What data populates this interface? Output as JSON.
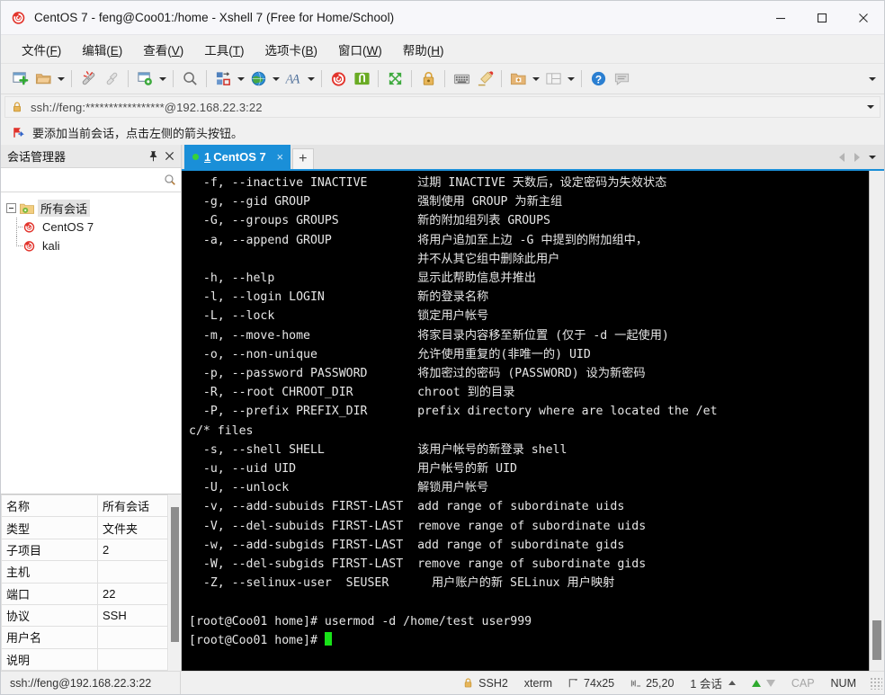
{
  "window": {
    "title": "CentOS 7 - feng@Coo01:/home - Xshell 7 (Free for Home/School)",
    "app_icon": "xshell-snail-icon",
    "minimize_label": "—",
    "maximize_label": "□",
    "close_label": "✕"
  },
  "menubar": {
    "items": [
      {
        "label": "文件",
        "accel": "F"
      },
      {
        "label": "编辑",
        "accel": "E"
      },
      {
        "label": "查看",
        "accel": "V"
      },
      {
        "label": "工具",
        "accel": "T"
      },
      {
        "label": "选项卡",
        "accel": "B"
      },
      {
        "label": "窗口",
        "accel": "W"
      },
      {
        "label": "帮助",
        "accel": "H"
      }
    ]
  },
  "toolbar": {
    "buttons": [
      {
        "name": "new-session-icon",
        "dropdown": false
      },
      {
        "name": "open-folder-icon",
        "dropdown": true
      },
      {
        "name": "disconnect-icon",
        "dropdown": false
      },
      {
        "name": "reconnect-icon",
        "dropdown": false
      },
      {
        "name": "session-properties-icon",
        "dropdown": true
      },
      {
        "name": "find-icon",
        "dropdown": false
      },
      {
        "name": "file-transfer-icon",
        "dropdown": true
      },
      {
        "name": "web-browser-icon",
        "dropdown": true
      },
      {
        "name": "font-icon",
        "dropdown": true
      },
      {
        "name": "xshell-icon",
        "dropdown": false
      },
      {
        "name": "xftp-icon",
        "dropdown": false
      },
      {
        "name": "fullscreen-icon",
        "dropdown": false
      },
      {
        "name": "lock-icon",
        "dropdown": false
      },
      {
        "name": "keyboard-icon",
        "dropdown": false
      },
      {
        "name": "highlight-icon",
        "dropdown": false
      },
      {
        "name": "add-folder-icon",
        "dropdown": true
      },
      {
        "name": "layout-icon",
        "dropdown": true
      },
      {
        "name": "help-icon",
        "dropdown": false
      },
      {
        "name": "chat-icon",
        "dropdown": false
      }
    ],
    "overflow_name": "toolbar-overflow-chevron"
  },
  "address": {
    "lock_icon": "lock-icon",
    "value": "ssh://feng:*****************@192.168.22.3:22",
    "dropdown_name": "address-dropdown-chevron"
  },
  "notice": {
    "icon": "red-flag-icon",
    "text": "要添加当前会话，点击左侧的箭头按钮。"
  },
  "sidebar": {
    "title": "会话管理器",
    "pin_icon": "pin-icon",
    "close_icon": "close-icon",
    "search": {
      "value": "",
      "placeholder": "",
      "icon": "search-icon"
    },
    "tree": {
      "root": {
        "label": "所有会话",
        "icon": "folder-sessions-icon",
        "selected": true
      },
      "children": [
        {
          "label": "CentOS 7",
          "icon": "xshell-session-icon"
        },
        {
          "label": "kali",
          "icon": "xshell-session-icon"
        }
      ]
    },
    "properties": [
      {
        "key": "名称",
        "value": "所有会话"
      },
      {
        "key": "类型",
        "value": "文件夹"
      },
      {
        "key": "子项目",
        "value": "2"
      },
      {
        "key": "主机",
        "value": ""
      },
      {
        "key": "端口",
        "value": "22"
      },
      {
        "key": "协议",
        "value": "SSH"
      },
      {
        "key": "用户名",
        "value": ""
      },
      {
        "key": "说明",
        "value": ""
      }
    ]
  },
  "tabs": {
    "items": [
      {
        "number": "1",
        "label": "CentOS 7",
        "active": true,
        "status_dot": "#37d13a",
        "close_label": "×"
      }
    ],
    "new_tab_label": "+",
    "nav_prev_name": "tab-scroll-left-icon",
    "nav_next_name": "tab-scroll-right-icon",
    "tab_list_name": "tab-list-chevron"
  },
  "terminal": {
    "lines": [
      "  -f, --inactive INACTIVE       过期 INACTIVE 天数后，设定密码为失效状态",
      "  -g, --gid GROUP               强制使用 GROUP 为新主组",
      "  -G, --groups GROUPS           新的附加组列表 GROUPS",
      "  -a, --append GROUP            将用户追加至上边 -G 中提到的附加组中，",
      "                                并不从其它组中删除此用户",
      "  -h, --help                    显示此帮助信息并推出",
      "  -l, --login LOGIN             新的登录名称",
      "  -L, --lock                    锁定用户帐号",
      "  -m, --move-home               将家目录内容移至新位置 (仅于 -d 一起使用)",
      "  -o, --non-unique              允许使用重复的(非唯一的) UID",
      "  -p, --password PASSWORD       将加密过的密码 (PASSWORD) 设为新密码",
      "  -R, --root CHROOT_DIR         chroot 到的目录",
      "  -P, --prefix PREFIX_DIR       prefix directory where are located the /et",
      "c/* files",
      "  -s, --shell SHELL             该用户帐号的新登录 shell",
      "  -u, --uid UID                 用户帐号的新 UID",
      "  -U, --unlock                  解锁用户帐号",
      "  -v, --add-subuids FIRST-LAST  add range of subordinate uids",
      "  -V, --del-subuids FIRST-LAST  remove range of subordinate uids",
      "  -w, --add-subgids FIRST-LAST  add range of subordinate gids",
      "  -W, --del-subgids FIRST-LAST  remove range of subordinate gids",
      "  -Z, --selinux-user  SEUSER      用户账户的新 SELinux 用户映射",
      "",
      "[root@Coo01 home]# usermod -d /home/test user999"
    ],
    "prompt": "[root@Coo01 home]# ",
    "cursor_color": "#18e218",
    "bg": "#000000",
    "fg": "#e6e6e6"
  },
  "statusbar": {
    "connection": "ssh://feng@192.168.22.3:22",
    "protocol": "SSH2",
    "terminal_type": "xterm",
    "size_icon": "resize-icon",
    "size": "74x25",
    "cursor_icon": "cursor-pos-icon",
    "cursor_pos": "25,20",
    "sessions": "1 会话",
    "upload_icon": "arrow-up-icon",
    "download_icon": "arrow-down-icon",
    "cap": "CAP",
    "num": "NUM"
  }
}
